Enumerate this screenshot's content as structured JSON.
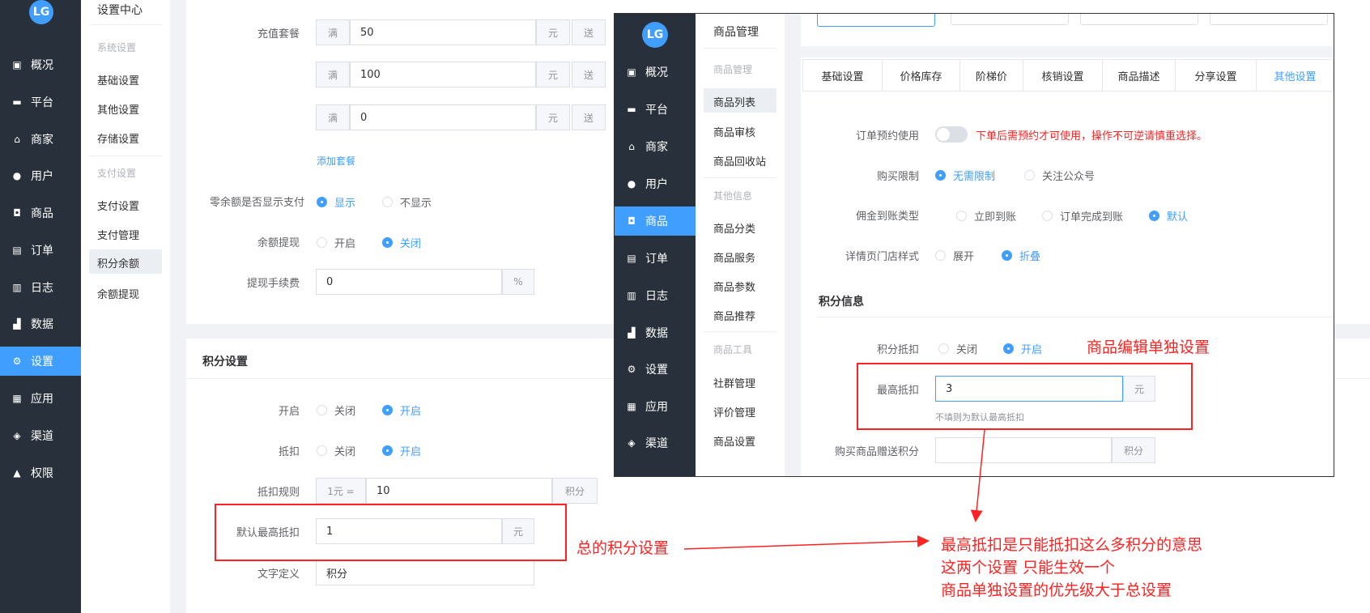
{
  "left_nav": {
    "items": [
      {
        "label": "概况",
        "icon": "overview-icon",
        "glyph": "▣"
      },
      {
        "label": "平台",
        "icon": "platform-icon",
        "glyph": "▬"
      },
      {
        "label": "商家",
        "icon": "store-icon",
        "glyph": "⌂"
      },
      {
        "label": "用户",
        "icon": "user-icon",
        "glyph": "●"
      },
      {
        "label": "商品",
        "icon": "goods-icon",
        "glyph": "◘"
      },
      {
        "label": "订单",
        "icon": "order-icon",
        "glyph": "▤"
      },
      {
        "label": "日志",
        "icon": "log-icon",
        "glyph": "▥"
      },
      {
        "label": "数据",
        "icon": "data-icon",
        "glyph": "▟"
      },
      {
        "label": "设置",
        "icon": "settings-icon",
        "glyph": "⚙"
      },
      {
        "label": "应用",
        "icon": "apps-icon",
        "glyph": "▦"
      },
      {
        "label": "渠道",
        "icon": "channel-icon",
        "glyph": "◈"
      },
      {
        "label": "权限",
        "icon": "lock-icon",
        "glyph": "▲"
      }
    ],
    "active_index": 8
  },
  "settings_menu": {
    "title": "设置中心",
    "group1": "系统设置",
    "items1": [
      "基础设置",
      "其他设置",
      "存储设置"
    ],
    "group2": "支付设置",
    "items2": [
      "支付设置",
      "支付管理",
      "积分余额",
      "余额提现"
    ],
    "active": "积分余额"
  },
  "recharge": {
    "label": "充值套餐",
    "rows": [
      {
        "prefix": "满",
        "value": "50",
        "unit": "元",
        "gift": "送"
      },
      {
        "prefix": "满",
        "value": "100",
        "unit": "元",
        "gift": "送"
      },
      {
        "prefix": "满",
        "value": "0",
        "unit": "元",
        "gift": "送"
      }
    ],
    "add_link": "添加套餐"
  },
  "zero_balance": {
    "label": "零余额是否显示支付",
    "opt_on": "显示",
    "opt_off": "不显示"
  },
  "withdraw": {
    "label": "余额提现",
    "opt_open": "开启",
    "opt_close": "关闭"
  },
  "fee": {
    "label": "提现手续费",
    "value": "0",
    "unit": "%"
  },
  "points": {
    "section": "积分设置",
    "enable": {
      "label": "开启",
      "off": "关闭",
      "on": "开启"
    },
    "deduct": {
      "label": "抵扣",
      "off": "关闭",
      "on": "开启"
    },
    "rule": {
      "label": "抵扣规则",
      "prefix": "1元 =",
      "value": "10",
      "unit": "积分"
    },
    "max": {
      "label": "默认最高抵扣",
      "value": "1",
      "unit": "元"
    },
    "text": {
      "label": "文字定义",
      "value": "积分"
    }
  },
  "overlay": {
    "menu_title": "商品管理",
    "menu_group1": "商品管理",
    "menu_items1": [
      "商品列表",
      "商品审核",
      "商品回收站"
    ],
    "menu_group2": "其他信息",
    "menu_items2": [
      "商品分类",
      "商品服务",
      "商品参数",
      "商品推荐"
    ],
    "menu_group3": "商品工具",
    "menu_items3": [
      "社群管理",
      "评价管理",
      "商品设置"
    ],
    "menu_active": "商品列表",
    "nav_items": [
      {
        "label": "概况",
        "icon": "overview-icon",
        "glyph": "▣"
      },
      {
        "label": "平台",
        "icon": "platform-icon",
        "glyph": "▬"
      },
      {
        "label": "商家",
        "icon": "store-icon",
        "glyph": "⌂"
      },
      {
        "label": "用户",
        "icon": "user-icon",
        "glyph": "●"
      },
      {
        "label": "商品",
        "icon": "goods-icon",
        "glyph": "◘"
      },
      {
        "label": "订单",
        "icon": "order-icon",
        "glyph": "▤"
      },
      {
        "label": "日志",
        "icon": "log-icon",
        "glyph": "▥"
      },
      {
        "label": "数据",
        "icon": "data-icon",
        "glyph": "▟"
      },
      {
        "label": "设置",
        "icon": "settings-icon",
        "glyph": "⚙"
      },
      {
        "label": "应用",
        "icon": "apps-icon",
        "glyph": "▦"
      },
      {
        "label": "渠道",
        "icon": "channel-icon",
        "glyph": "◈"
      }
    ],
    "nav_active_index": 4,
    "tabs": [
      "基础设置",
      "价格库存",
      "阶梯价",
      "核销设置",
      "商品描述",
      "分享设置",
      "其他设置"
    ],
    "tab_active": "其他设置",
    "reserve": {
      "label": "订单预约使用",
      "warning": "下单后需预约才可使用，操作不可逆请慎重选择。"
    },
    "limit": {
      "label": "购买限制",
      "opt1": "无需限制",
      "opt2": "关注公众号"
    },
    "commission": {
      "label": "佣金到账类型",
      "opt1": "立即到账",
      "opt2": "订单完成到账",
      "opt3": "默认"
    },
    "store_style": {
      "label": "详情页门店样式",
      "opt1": "展开",
      "opt2": "折叠"
    },
    "points_section": "积分信息",
    "points_deduct": {
      "label": "积分抵扣",
      "off": "关闭",
      "on": "开启"
    },
    "max_deduct": {
      "label": "最高抵扣",
      "value": "3",
      "unit": "元",
      "hint": "不填则为默认最高抵扣"
    },
    "gift_points": {
      "label": "购买商品赠送积分",
      "unit": "积分"
    }
  },
  "annotations": {
    "goods_edit": "商品编辑单独设置",
    "total_setting": "总的积分设置",
    "explain_lines": [
      "最高抵扣是只能抵扣这么多积分的意思",
      "这两个设置 只能生效一个",
      "商品单独设置的优先级大于总设置"
    ]
  },
  "colors": {
    "accent": "#409eff",
    "sidebar": "#28313b",
    "annotation": "#ff2222"
  }
}
